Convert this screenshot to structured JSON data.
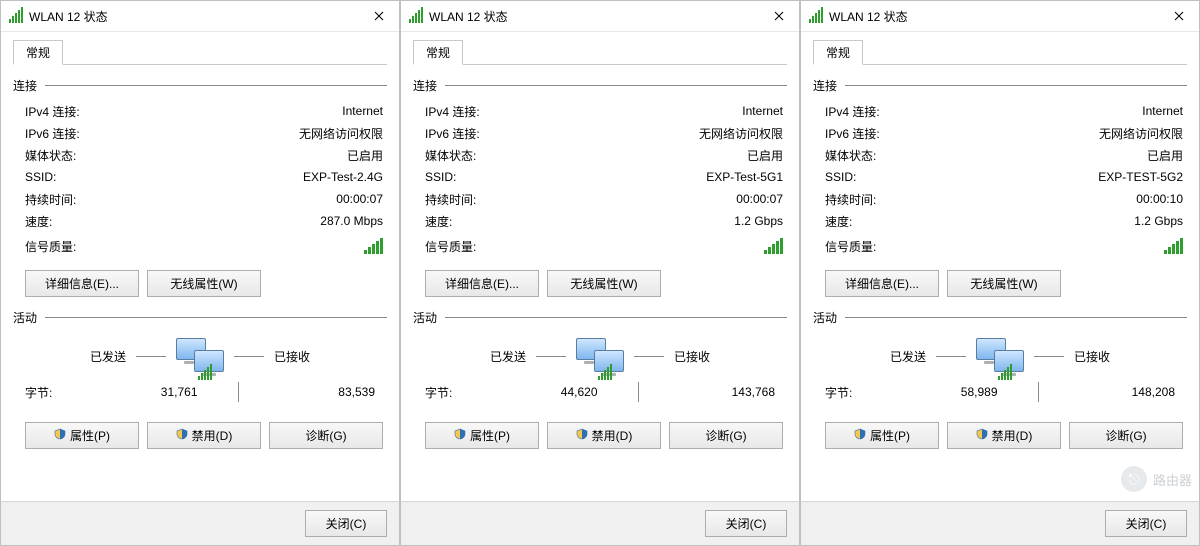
{
  "labels": {
    "window_title": "WLAN 12 状态",
    "tab_general": "常规",
    "section_connection": "连接",
    "section_activity": "活动",
    "ipv4": "IPv4 连接:",
    "ipv6": "IPv6 连接:",
    "media": "媒体状态:",
    "ssid": "SSID:",
    "duration": "持续时间:",
    "speed": "速度:",
    "signal": "信号质量:",
    "details_btn": "详细信息(E)...",
    "wireless_btn": "无线属性(W)",
    "sent": "已发送",
    "received": "已接收",
    "bytes": "字节:",
    "properties_btn": "属性(P)",
    "disable_btn": "禁用(D)",
    "diagnose_btn": "诊断(G)",
    "close_btn": "关闭(C)"
  },
  "windows": [
    {
      "ipv4": "Internet",
      "ipv6": "无网络访问权限",
      "media": "已启用",
      "ssid": "EXP-Test-2.4G",
      "duration": "00:00:07",
      "speed": "287.0 Mbps",
      "bytes_sent": "31,761",
      "bytes_recv": "83,539"
    },
    {
      "ipv4": "Internet",
      "ipv6": "无网络访问权限",
      "media": "已启用",
      "ssid": "EXP-Test-5G1",
      "duration": "00:00:07",
      "speed": "1.2 Gbps",
      "bytes_sent": "44,620",
      "bytes_recv": "143,768"
    },
    {
      "ipv4": "Internet",
      "ipv6": "无网络访问权限",
      "media": "已启用",
      "ssid": "EXP-TEST-5G2",
      "duration": "00:00:10",
      "speed": "1.2 Gbps",
      "bytes_sent": "58,989",
      "bytes_recv": "148,208"
    }
  ],
  "watermark": "路由器"
}
